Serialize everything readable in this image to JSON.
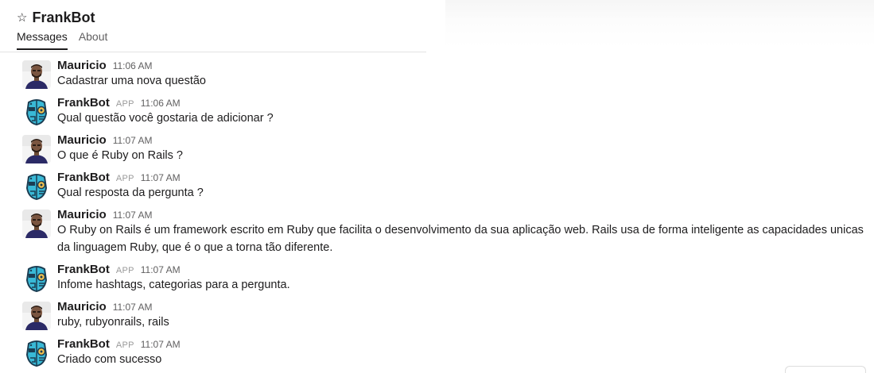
{
  "channel": {
    "title": "FrankBot",
    "star_icon": "star-icon"
  },
  "tabs": [
    {
      "label": "Messages",
      "active": true
    },
    {
      "label": "About",
      "active": false
    }
  ],
  "messages": [
    {
      "sender": "Mauricio",
      "badge": "",
      "time": "11:06 AM",
      "text": "Cadastrar uma nova questão",
      "avatar": "user-avatar"
    },
    {
      "sender": "FrankBot",
      "badge": "APP",
      "time": "11:06 AM",
      "text": "Qual questão você gostaria de adicionar ?",
      "avatar": "bot-avatar"
    },
    {
      "sender": "Mauricio",
      "badge": "",
      "time": "11:07 AM",
      "text": "O que é Ruby on Rails ?",
      "avatar": "user-avatar"
    },
    {
      "sender": "FrankBot",
      "badge": "APP",
      "time": "11:07 AM",
      "text": "Qual resposta da pergunta ?",
      "avatar": "bot-avatar"
    },
    {
      "sender": "Mauricio",
      "badge": "",
      "time": "11:07 AM",
      "text": "O Ruby on Rails é um framework escrito em Ruby que facilita o desenvolvimento da sua aplicação web. Rails usa de forma inteligente as capacidades unicas da linguagem Ruby, que é o que a torna tão diferente.",
      "avatar": "user-avatar"
    },
    {
      "sender": "FrankBot",
      "badge": "APP",
      "time": "11:07 AM",
      "text": "Infome hashtags, categorias para a pergunta.",
      "avatar": "bot-avatar"
    },
    {
      "sender": "Mauricio",
      "badge": "",
      "time": "11:07 AM",
      "text": "ruby, rubyonrails, rails",
      "avatar": "user-avatar"
    },
    {
      "sender": "FrankBot",
      "badge": "APP",
      "time": "11:07 AM",
      "text": "Criado com sucesso",
      "avatar": "bot-avatar"
    }
  ],
  "colors": {
    "bot_teal": "#39b9d6",
    "user_shirt": "#2b2a66"
  }
}
